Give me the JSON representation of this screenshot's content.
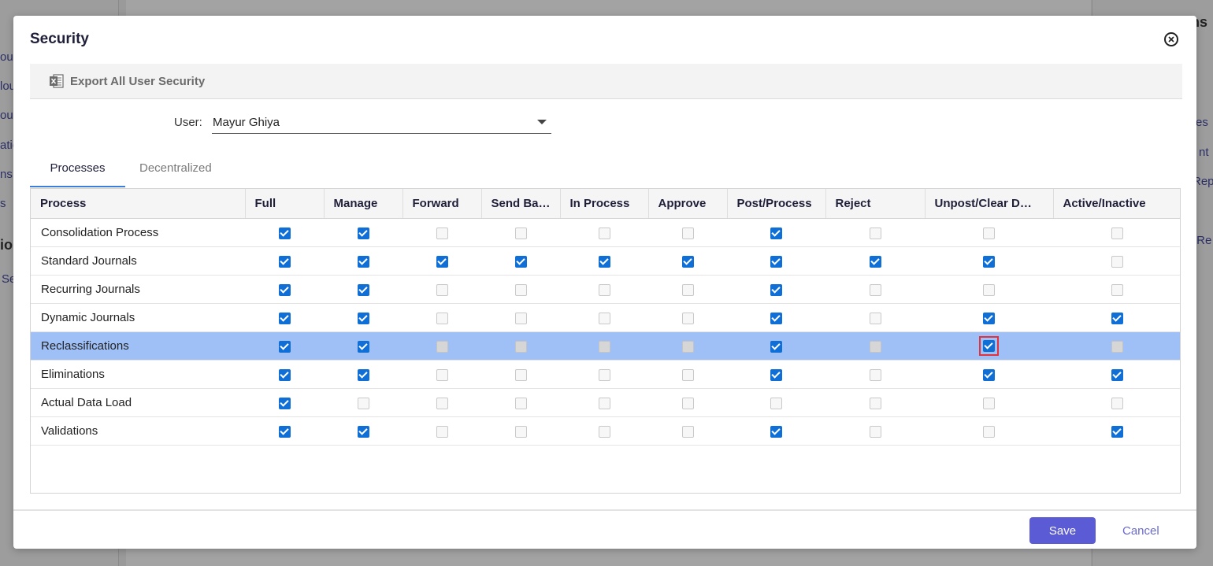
{
  "background": {
    "left_fragments": [
      "ou",
      "lou",
      "ou",
      "atio",
      "ns",
      "s",
      "ion",
      "Se"
    ],
    "right_fragments": [
      "ns",
      "es",
      "nt",
      "Rep",
      "r Re"
    ]
  },
  "dialog": {
    "title": "Security",
    "close_icon": "close-circle-icon"
  },
  "toolbar": {
    "export_label": "Export All User Security",
    "export_icon": "excel-icon"
  },
  "user": {
    "label": "User:",
    "value": "Mayur Ghiya"
  },
  "tabs": [
    {
      "label": "Processes",
      "active": true
    },
    {
      "label": "Decentralized",
      "active": false
    }
  ],
  "grid": {
    "columns": [
      "Process",
      "Full",
      "Manage",
      "Forward",
      "Send Ba…",
      "In Process",
      "Approve",
      "Post/Process",
      "Reject",
      "Unpost/Clear D…",
      "Active/Inactive"
    ],
    "rows": [
      {
        "name": "Consolidation Process",
        "checks": [
          1,
          1,
          0,
          0,
          0,
          0,
          1,
          0,
          0,
          0
        ]
      },
      {
        "name": "Standard Journals",
        "checks": [
          1,
          1,
          1,
          1,
          1,
          1,
          1,
          1,
          1,
          0
        ]
      },
      {
        "name": "Recurring Journals",
        "checks": [
          1,
          1,
          0,
          0,
          0,
          0,
          1,
          0,
          0,
          0
        ]
      },
      {
        "name": "Dynamic Journals",
        "checks": [
          1,
          1,
          0,
          0,
          0,
          0,
          1,
          0,
          1,
          1
        ]
      },
      {
        "name": "Reclassifications",
        "checks": [
          1,
          1,
          0,
          0,
          0,
          0,
          1,
          0,
          1,
          0
        ],
        "selected": true,
        "highlight_col": 8
      },
      {
        "name": "Eliminations",
        "checks": [
          1,
          1,
          0,
          0,
          0,
          0,
          1,
          0,
          1,
          1
        ]
      },
      {
        "name": "Actual Data Load",
        "checks": [
          1,
          0,
          0,
          0,
          0,
          0,
          0,
          0,
          0,
          0
        ]
      },
      {
        "name": "Validations",
        "checks": [
          1,
          1,
          0,
          0,
          0,
          0,
          1,
          0,
          0,
          1
        ]
      }
    ]
  },
  "footer": {
    "save_label": "Save",
    "cancel_label": "Cancel"
  },
  "colors": {
    "accent": "#5b5bd6",
    "checkbox": "#0f6fd6",
    "selected_row": "#9ec0f7",
    "highlight": "#e2323b"
  }
}
